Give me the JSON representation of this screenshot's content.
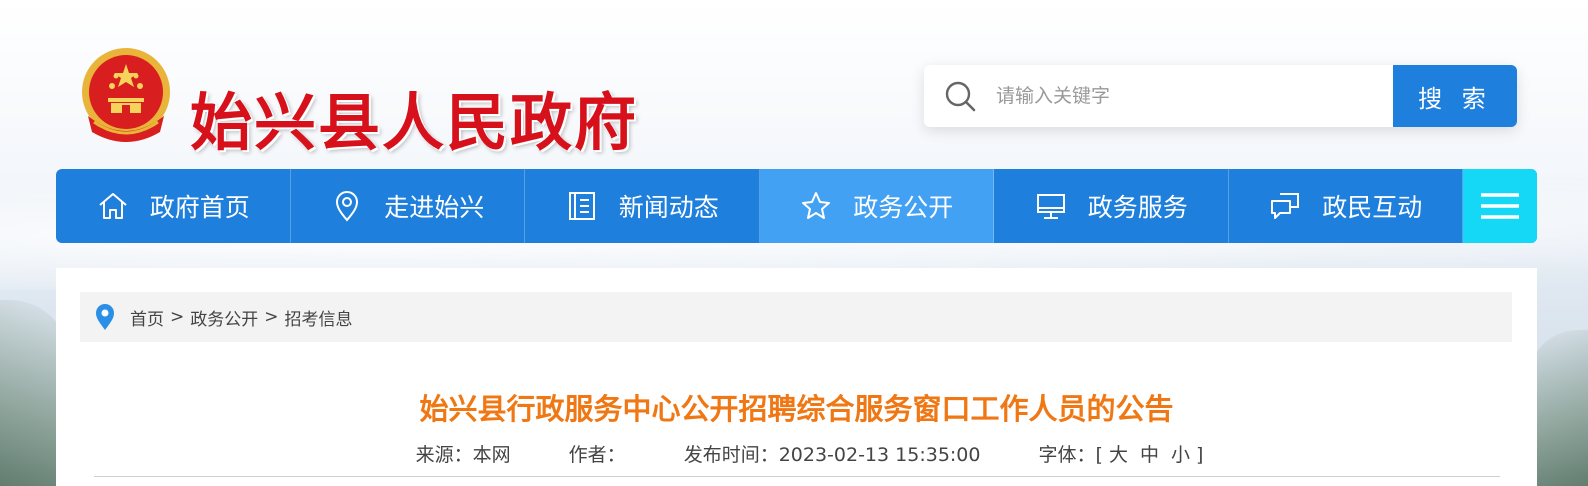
{
  "site": {
    "title": "始兴县人民政府"
  },
  "search": {
    "placeholder": "请输入关键字",
    "button_label": "搜 索",
    "icon": "search-icon"
  },
  "nav": {
    "items": [
      {
        "label": "政府首页",
        "icon": "home-icon"
      },
      {
        "label": "走进始兴",
        "icon": "location-icon"
      },
      {
        "label": "新闻动态",
        "icon": "news-icon"
      },
      {
        "label": "政务公开",
        "icon": "star-icon",
        "active": true
      },
      {
        "label": "政务服务",
        "icon": "monitor-icon"
      },
      {
        "label": "政民互动",
        "icon": "chat-icon"
      }
    ],
    "menu_icon": "hamburger-menu-icon"
  },
  "breadcrumb": {
    "items": [
      "首页",
      "政务公开",
      "招考信息"
    ],
    "separator": ">"
  },
  "article": {
    "title": "始兴县行政服务中心公开招聘综合服务窗口工作人员的公告",
    "source_label": "来源：本网",
    "author_label": "作者：",
    "publish_label": "发布时间：2023-02-13 15:35:00",
    "font_label": "字体：[",
    "font_large": "大",
    "font_medium": "中",
    "font_small": "小",
    "font_close": "]"
  },
  "colors": {
    "primary": "#1f7fdc",
    "nav_active": "#42a1f2",
    "menu_button": "#14d8f5",
    "title_red": "#d6111b",
    "article_title": "#f07814"
  }
}
